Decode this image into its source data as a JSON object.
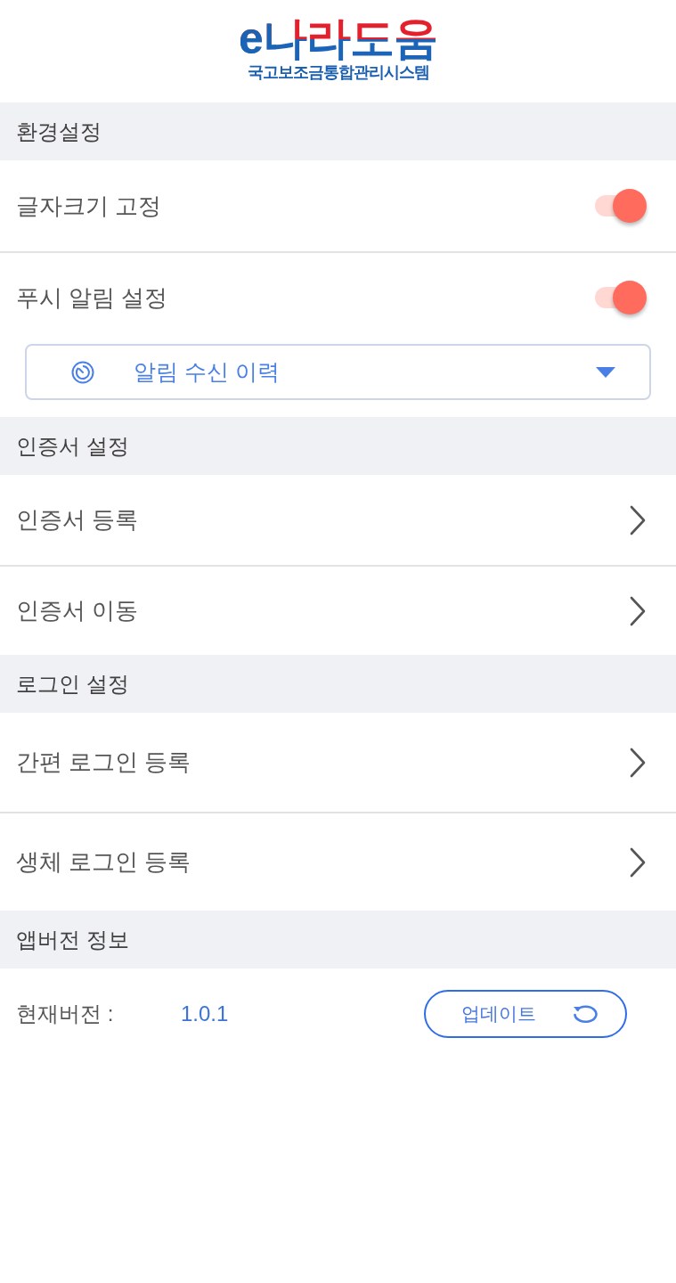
{
  "header": {
    "logo_title": "e나라도움",
    "logo_subtitle": "국고보조금통합관리시스템"
  },
  "sections": [
    {
      "title": "환경설정",
      "items": [
        {
          "kind": "toggle",
          "label": "글자크기 고정",
          "on": true
        },
        {
          "kind": "toggle",
          "label": "푸시 알림 설정",
          "on": true
        },
        {
          "kind": "dropdown",
          "label": "알림 수신 이력"
        }
      ]
    },
    {
      "title": "인증서 설정",
      "items": [
        {
          "kind": "link",
          "label": "인증서 등록"
        },
        {
          "kind": "link",
          "label": "인증서 이동"
        }
      ]
    },
    {
      "title": "로그인 설정",
      "items": [
        {
          "kind": "link",
          "label": "간편 로그인 등록"
        },
        {
          "kind": "link",
          "label": "생체 로그인 등록"
        }
      ]
    },
    {
      "title": "앱버전 정보",
      "items": [
        {
          "kind": "version",
          "label": "현재버전 :",
          "value": "1.0.1",
          "button": "업데이트"
        }
      ]
    }
  ]
}
